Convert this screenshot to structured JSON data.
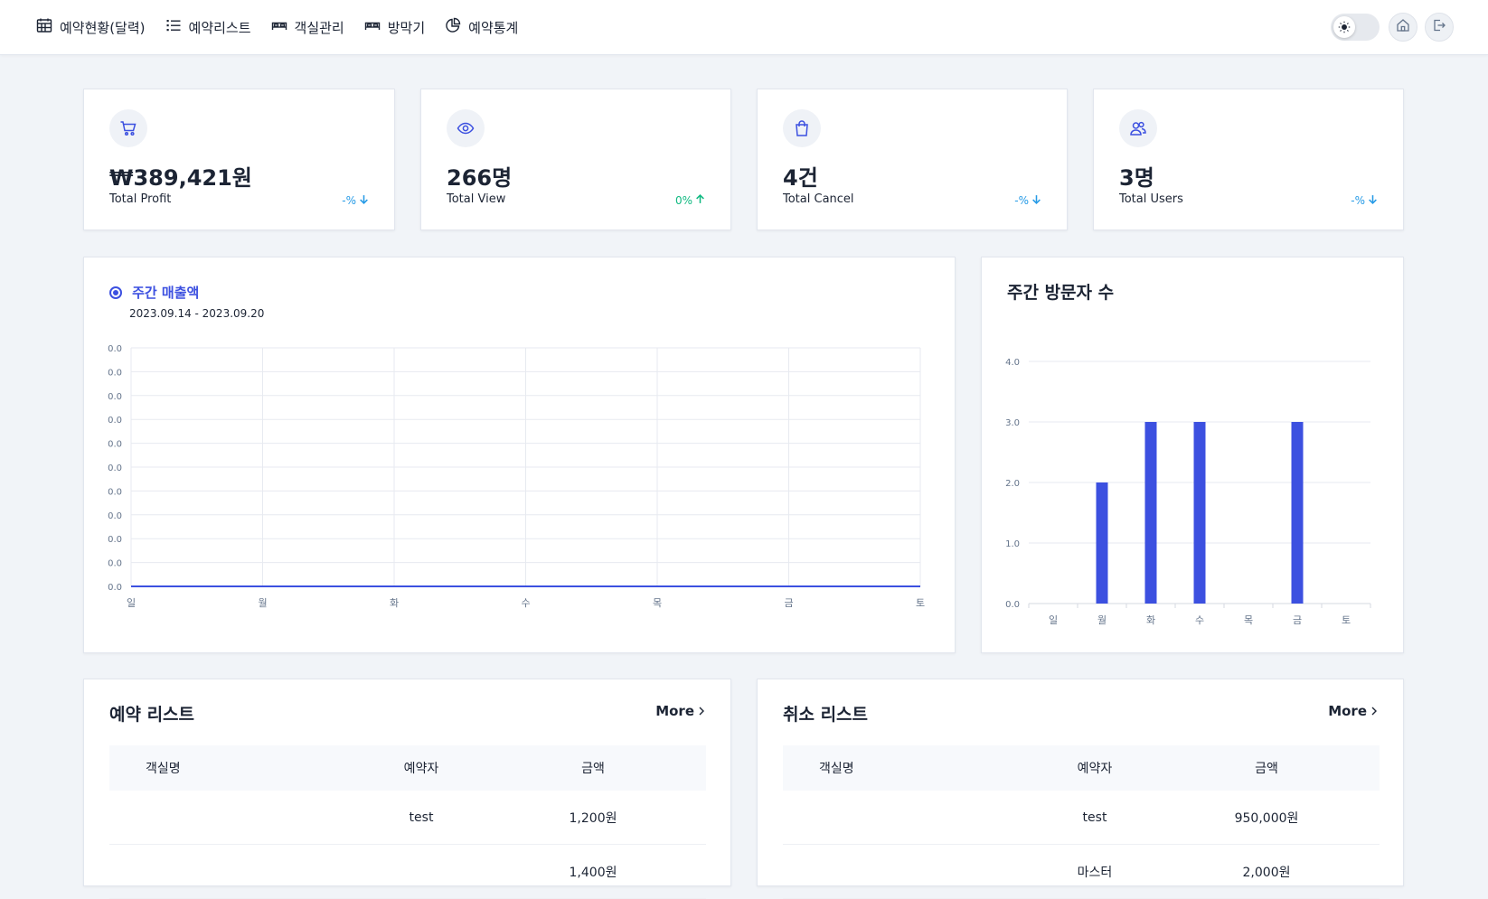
{
  "nav": [
    {
      "label": "예약현황(달력)",
      "icon": "calendar-icon"
    },
    {
      "label": "예약리스트",
      "icon": "list-icon"
    },
    {
      "label": "객실관리",
      "icon": "bed-icon"
    },
    {
      "label": "방막기",
      "icon": "bed-block-icon"
    },
    {
      "label": "예약통계",
      "icon": "pie-chart-icon"
    }
  ],
  "stats": [
    {
      "value": "₩389,421원",
      "label": "Total Profit",
      "delta": "-%",
      "trend": "down",
      "icon": "cart-icon"
    },
    {
      "value": "266명",
      "label": "Total View",
      "delta": "0%",
      "trend": "up",
      "icon": "eye-icon"
    },
    {
      "value": "4건",
      "label": "Total Cancel",
      "delta": "-%",
      "trend": "down",
      "icon": "bag-icon"
    },
    {
      "value": "3명",
      "label": "Total Users",
      "delta": "-%",
      "trend": "down",
      "icon": "users-icon"
    }
  ],
  "colors": {
    "accent": "#3c50e0",
    "down": "#259ae6",
    "up": "#10b981"
  },
  "chart_data": [
    {
      "type": "line",
      "series": [
        {
          "name": "주간 매출액",
          "values": [
            0,
            0,
            0,
            0,
            0,
            0,
            0
          ]
        }
      ],
      "subtitle": "2023.09.14 - 2023.09.20",
      "categories": [
        "일",
        "월",
        "화",
        "수",
        "목",
        "금",
        "토"
      ],
      "ytick_labels": [
        "0.0",
        "0.0",
        "0.0",
        "0.0",
        "0.0",
        "0.0",
        "0.0",
        "0.0",
        "0.0",
        "0.0",
        "0.0"
      ],
      "grid": true
    },
    {
      "type": "bar",
      "title": "주간 방문자 수",
      "categories": [
        "일",
        "월",
        "화",
        "수",
        "목",
        "금",
        "토"
      ],
      "values": [
        0,
        2,
        3,
        3,
        0,
        3,
        0
      ],
      "ytick_labels": [
        "4.0",
        "3.0",
        "2.0",
        "1.0",
        "0.0"
      ],
      "ylim": [
        0,
        4
      ],
      "grid": true
    }
  ],
  "reservations": {
    "title": "예약 리스트",
    "more": "More",
    "columns": [
      "객실명",
      "예약자",
      "금액"
    ],
    "rows": [
      [
        "",
        "test",
        "1,200원"
      ],
      [
        "",
        "",
        "1,400원"
      ]
    ]
  },
  "cancellations": {
    "title": "취소 리스트",
    "more": "More",
    "columns": [
      "객실명",
      "예약자",
      "금액"
    ],
    "rows": [
      [
        "",
        "test",
        "950,000원"
      ],
      [
        "",
        "마스터",
        "2,000원"
      ]
    ]
  }
}
